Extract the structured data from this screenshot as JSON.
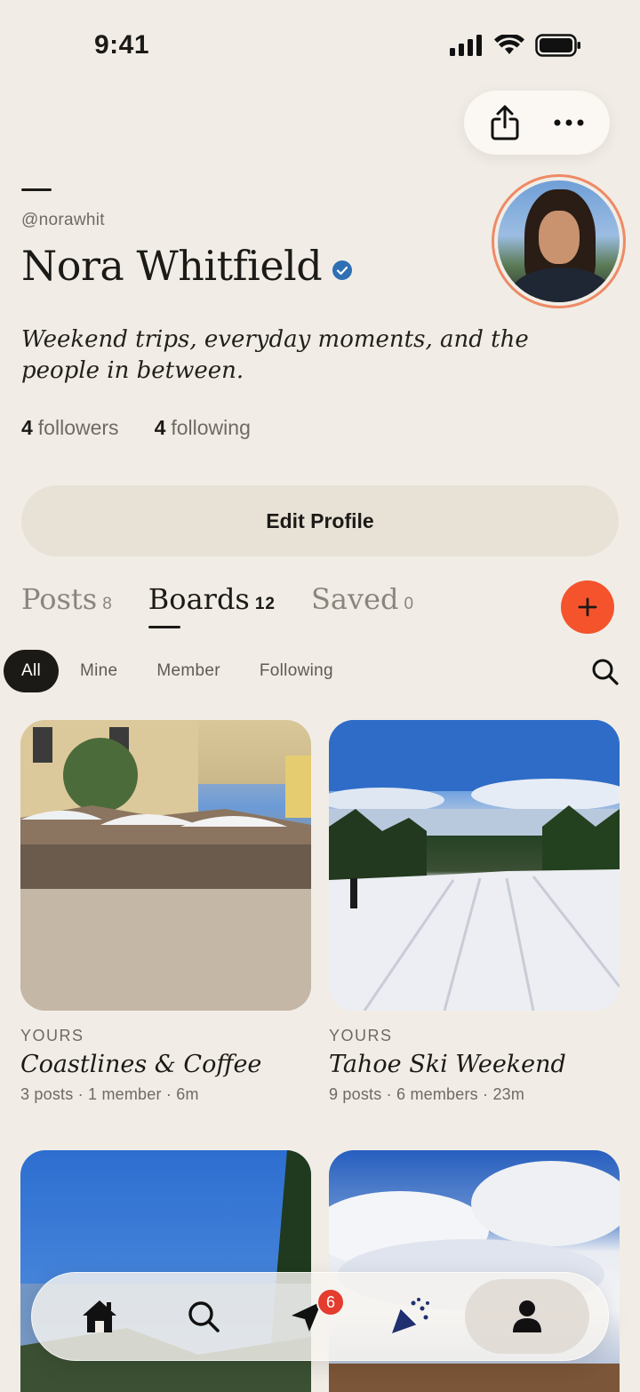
{
  "status_bar": {
    "time": "9:41"
  },
  "profile": {
    "handle": "@norawhit",
    "name": "Nora Whitfield",
    "bio": "Weekend trips, everyday moments, and the people in between.",
    "followers_count": "4",
    "followers_label": "followers",
    "following_count": "4",
    "following_label": "following",
    "edit_label": "Edit Profile"
  },
  "tabs": [
    {
      "label": "Posts",
      "count": "8"
    },
    {
      "label": "Boards",
      "count": "12"
    },
    {
      "label": "Saved",
      "count": "0"
    }
  ],
  "active_tab": "Boards",
  "filters": [
    "All",
    "Mine",
    "Member",
    "Following"
  ],
  "active_filter": "All",
  "boards": [
    {
      "eyebrow": "YOURS",
      "title": "Coastlines & Coffee",
      "meta": "3 posts · 1 member · 6m"
    },
    {
      "eyebrow": "YOURS",
      "title": "Tahoe Ski Weekend",
      "meta": "9 posts · 6 members · 23m"
    }
  ],
  "bottom_nav": {
    "items": [
      "home-icon",
      "search-icon",
      "send-icon",
      "party-icon",
      "profile-icon"
    ],
    "messages_badge": "6",
    "active": "profile-icon"
  },
  "colors": {
    "accent": "#f4532b",
    "avatar_ring": "#ee8a66",
    "verified": "#2f6fb3",
    "badge": "#e43c2f",
    "background": "#f1ede6"
  }
}
